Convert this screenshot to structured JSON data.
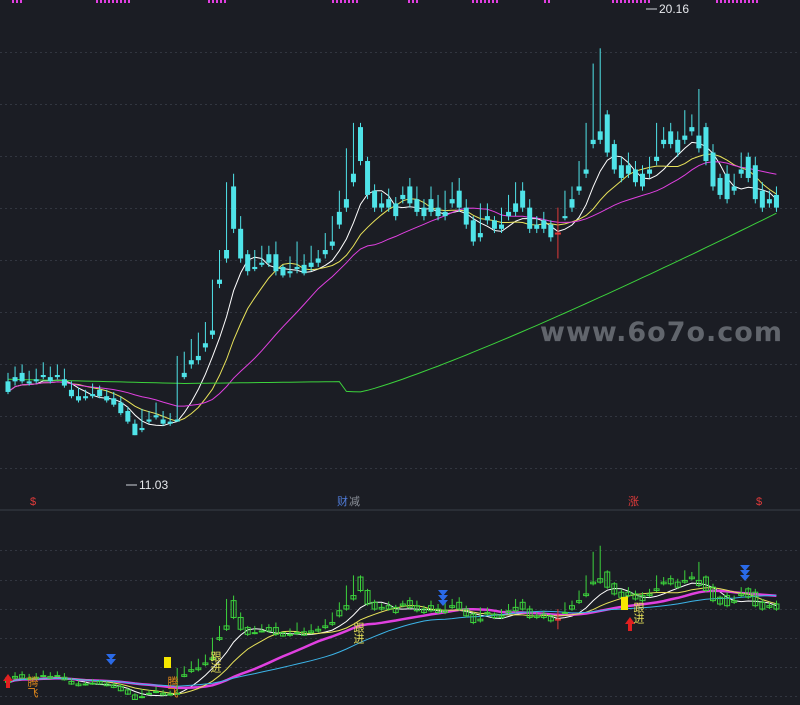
{
  "chart_data": [
    {
      "type": "candlestick",
      "panel": "main",
      "yrange": [
        9.5,
        21.3
      ],
      "grid": true,
      "up_color": "#e03a3a",
      "down_color": "#4fe3e8",
      "annotations": {
        "high_label": "20.16",
        "low_label": "11.03"
      },
      "markers": [
        {
          "text": "$",
          "color": "#e03a3a"
        },
        {
          "text": "财",
          "color": "#4f7bd8"
        },
        {
          "text": "减",
          "color": "#8a8f98"
        },
        {
          "text": "涨",
          "color": "#e03a3a"
        },
        {
          "text": "$",
          "color": "#e03a3a"
        }
      ],
      "candles": [
        [
          12.3,
          12.5,
          12.05,
          12.0
        ],
        [
          12.4,
          12.65,
          12.3,
          12.2
        ],
        [
          12.5,
          12.7,
          12.3,
          12.25
        ],
        [
          12.3,
          12.55,
          12.25,
          12.2
        ],
        [
          12.35,
          12.6,
          12.3,
          12.25
        ],
        [
          12.45,
          12.75,
          12.4,
          12.35
        ],
        [
          12.4,
          12.65,
          12.3,
          12.25
        ],
        [
          12.45,
          12.7,
          12.4,
          12.35
        ],
        [
          12.35,
          12.6,
          12.2,
          12.15
        ],
        [
          12.1,
          12.3,
          11.95,
          11.9
        ],
        [
          11.95,
          12.15,
          11.85,
          11.8
        ],
        [
          11.95,
          12.1,
          11.9,
          11.85
        ],
        [
          12.0,
          12.25,
          11.95,
          11.9
        ],
        [
          12.1,
          12.2,
          11.95,
          11.9
        ],
        [
          11.95,
          12.1,
          11.85,
          11.8
        ],
        [
          11.9,
          12.05,
          11.75,
          11.7
        ],
        [
          11.8,
          11.95,
          11.55,
          11.5
        ],
        [
          11.6,
          11.7,
          11.35,
          11.3
        ],
        [
          11.3,
          11.4,
          11.03,
          11.03
        ],
        [
          11.2,
          11.65,
          11.15,
          11.1
        ],
        [
          11.4,
          11.6,
          11.35,
          11.3
        ],
        [
          11.5,
          11.8,
          11.45,
          11.4
        ],
        [
          11.4,
          11.6,
          11.3,
          11.25
        ],
        [
          11.35,
          11.55,
          11.3,
          11.25
        ],
        [
          11.4,
          12.9,
          11.35,
          11.35
        ],
        [
          12.5,
          13.0,
          12.4,
          12.35
        ],
        [
          12.8,
          13.3,
          12.7,
          12.6
        ],
        [
          12.9,
          13.45,
          12.8,
          12.7
        ],
        [
          13.2,
          13.7,
          13.1,
          13.0
        ],
        [
          13.5,
          14.7,
          13.4,
          13.3
        ],
        [
          14.7,
          15.4,
          14.6,
          14.5
        ],
        [
          15.4,
          17.0,
          15.2,
          15.1
        ],
        [
          16.9,
          17.2,
          15.9,
          15.8
        ],
        [
          15.9,
          16.2,
          15.2,
          15.1
        ],
        [
          15.3,
          15.4,
          14.9,
          14.8
        ],
        [
          15.0,
          15.4,
          14.95,
          14.9
        ],
        [
          15.1,
          15.5,
          15.05,
          15.0
        ],
        [
          15.3,
          15.5,
          15.1,
          15.0
        ],
        [
          15.3,
          15.6,
          14.9,
          14.8
        ],
        [
          15.0,
          15.05,
          14.8,
          14.75
        ],
        [
          14.9,
          15.25,
          14.85,
          14.75
        ],
        [
          15.0,
          15.6,
          14.95,
          14.85
        ],
        [
          15.05,
          15.3,
          14.85,
          14.8
        ],
        [
          15.1,
          15.5,
          15.0,
          14.9
        ],
        [
          15.2,
          15.4,
          15.1,
          15.0
        ],
        [
          15.4,
          15.8,
          15.3,
          15.2
        ],
        [
          15.6,
          16.2,
          15.5,
          15.4
        ],
        [
          16.3,
          16.8,
          16.0,
          15.9
        ],
        [
          16.6,
          17.8,
          16.4,
          16.3
        ],
        [
          17.2,
          18.4,
          17.0,
          16.9
        ],
        [
          18.3,
          18.4,
          17.5,
          17.4
        ],
        [
          17.5,
          17.6,
          16.7,
          16.6
        ],
        [
          16.8,
          16.95,
          16.4,
          16.3
        ],
        [
          16.5,
          16.75,
          16.4,
          16.3
        ],
        [
          16.6,
          16.85,
          16.4,
          16.3
        ],
        [
          16.5,
          16.65,
          16.2,
          16.1
        ],
        [
          16.7,
          16.9,
          16.6,
          16.5
        ],
        [
          16.9,
          17.1,
          16.5,
          16.4
        ],
        [
          16.6,
          16.9,
          16.3,
          16.2
        ],
        [
          16.4,
          16.6,
          16.2,
          16.1
        ],
        [
          16.6,
          16.9,
          16.3,
          16.2
        ],
        [
          16.4,
          16.7,
          16.2,
          16.1
        ],
        [
          16.3,
          16.8,
          16.2,
          16.1
        ],
        [
          16.6,
          17.0,
          16.5,
          16.4
        ],
        [
          16.8,
          17.1,
          16.4,
          16.3
        ],
        [
          16.4,
          16.6,
          16.0,
          15.9
        ],
        [
          16.1,
          16.2,
          15.6,
          15.5
        ],
        [
          15.8,
          16.5,
          15.7,
          15.6
        ],
        [
          16.2,
          16.5,
          16.1,
          16.0
        ],
        [
          16.1,
          16.2,
          15.9,
          15.8
        ],
        [
          16.0,
          16.4,
          15.9,
          15.8
        ],
        [
          16.3,
          16.7,
          16.2,
          16.1
        ],
        [
          16.5,
          17.0,
          16.3,
          16.2
        ],
        [
          16.8,
          17.0,
          16.4,
          16.3
        ],
        [
          16.4,
          16.6,
          15.9,
          15.8
        ],
        [
          16.0,
          16.2,
          15.9,
          15.8
        ],
        [
          16.1,
          16.3,
          15.9,
          15.8
        ],
        [
          16.0,
          16.1,
          15.7,
          15.6
        ],
        [
          15.8,
          16.4,
          15.8,
          15.2
        ],
        [
          16.2,
          16.8,
          16.15,
          16.1
        ],
        [
          16.6,
          16.9,
          16.4,
          16.3
        ],
        [
          16.9,
          17.5,
          16.8,
          16.7
        ],
        [
          17.3,
          18.4,
          17.2,
          17.1
        ],
        [
          18.0,
          19.8,
          17.9,
          17.8
        ],
        [
          18.2,
          20.16,
          18.0,
          17.9
        ],
        [
          18.6,
          18.7,
          17.7,
          17.6
        ],
        [
          17.9,
          18.0,
          17.3,
          17.2
        ],
        [
          17.4,
          17.6,
          17.1,
          17.0
        ],
        [
          17.4,
          17.7,
          17.2,
          17.1
        ],
        [
          17.3,
          17.5,
          17.0,
          16.9
        ],
        [
          17.2,
          17.4,
          16.9,
          16.8
        ],
        [
          17.3,
          17.6,
          17.2,
          17.1
        ],
        [
          17.6,
          18.4,
          17.5,
          17.4
        ],
        [
          18.0,
          18.3,
          17.9,
          17.8
        ],
        [
          18.2,
          18.4,
          17.9,
          17.8
        ],
        [
          18.0,
          18.2,
          17.7,
          17.6
        ],
        [
          18.1,
          18.7,
          18.0,
          17.9
        ],
        [
          18.3,
          18.6,
          18.2,
          18.1
        ],
        [
          18.1,
          19.2,
          17.8,
          17.7
        ],
        [
          18.3,
          18.4,
          17.5,
          17.4
        ],
        [
          17.7,
          17.9,
          16.9,
          16.8
        ],
        [
          17.1,
          17.2,
          16.7,
          16.6
        ],
        [
          17.2,
          17.4,
          16.6,
          16.5
        ],
        [
          16.9,
          17.2,
          16.8,
          16.7
        ],
        [
          17.3,
          17.7,
          17.2,
          17.1
        ],
        [
          17.6,
          17.7,
          17.1,
          17.0
        ],
        [
          17.4,
          17.6,
          16.6,
          16.5
        ],
        [
          16.8,
          17.0,
          16.4,
          16.3
        ],
        [
          16.6,
          16.8,
          16.5,
          16.4
        ],
        [
          16.7,
          16.9,
          16.4,
          16.3
        ]
      ],
      "ma_colors": [
        "#ffffff",
        "#e8e25a",
        "#e040e0",
        "#3cd23c"
      ]
    },
    {
      "type": "candlestick",
      "panel": "indicator",
      "yrange": [
        0,
        1
      ],
      "grid": true,
      "labels": [
        "腾飞",
        "腾飞",
        "跟进",
        "跟进",
        "跟进"
      ],
      "label_colors": [
        "#e58a1a",
        "#e58a1a",
        "#e8e25a",
        "#e8e25a",
        "#e8e25a"
      ],
      "up_arrow_color": "#e02020",
      "down_arrow_color": "#2a6ae8",
      "highlight_color": "#f5e600",
      "line_colors": [
        "#ffffff",
        "#e040e0",
        "#e8e25a",
        "#3cb4e8"
      ]
    }
  ],
  "watermark": "www.6o7o.com"
}
